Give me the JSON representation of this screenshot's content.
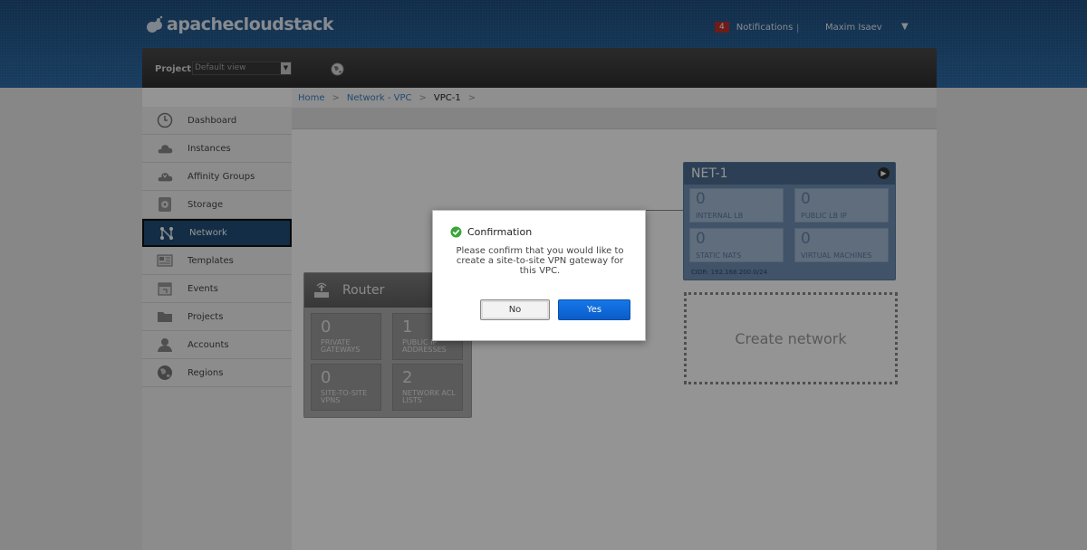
{
  "header": {
    "logo_text": "apachecloudstack",
    "notifications_count": "4",
    "notifications_label": "Notifications",
    "separator": "|",
    "user_name": "Maxim Isaev"
  },
  "project_bar": {
    "label": "Project:",
    "selected": "Default view"
  },
  "sidebar": {
    "items": [
      {
        "label": "Dashboard",
        "icon": "clock-icon"
      },
      {
        "label": "Instances",
        "icon": "cloud-icon"
      },
      {
        "label": "Affinity Groups",
        "icon": "cloud-group-icon"
      },
      {
        "label": "Storage",
        "icon": "disk-icon"
      },
      {
        "label": "Network",
        "icon": "network-icon",
        "active": true
      },
      {
        "label": "Templates",
        "icon": "template-icon"
      },
      {
        "label": "Events",
        "icon": "calendar-icon"
      },
      {
        "label": "Projects",
        "icon": "folder-icon"
      },
      {
        "label": "Accounts",
        "icon": "user-icon"
      },
      {
        "label": "Regions",
        "icon": "globe-icon"
      }
    ]
  },
  "breadcrumb": {
    "home": "Home",
    "network": "Network - VPC",
    "current": "VPC-1",
    "sep": ">"
  },
  "router": {
    "title": "Router",
    "tiles": [
      {
        "num": "0",
        "label1": "PRIVATE",
        "label2": "GATEWAYS"
      },
      {
        "num": "1",
        "label1": "PUBLIC IP",
        "label2": "ADDRESSES"
      },
      {
        "num": "0",
        "label1": "SITE-TO-SITE",
        "label2": "VPNS"
      },
      {
        "num": "2",
        "label1": "NETWORK ACL",
        "label2": "LISTS"
      }
    ]
  },
  "network_card": {
    "title": "NET-1",
    "tiles": [
      {
        "num": "0",
        "label": "INTERNAL LB"
      },
      {
        "num": "0",
        "label": "PUBLIC LB IP"
      },
      {
        "num": "0",
        "label": "STATIC NATS"
      },
      {
        "num": "0",
        "label": "VIRTUAL MACHINES"
      }
    ],
    "cidr": "CIDR: 192.168.200.0/24"
  },
  "create_network": "Create network",
  "dialog": {
    "title": "Confirmation",
    "message": "Please confirm that you would like to create a site-to-site VPN gateway for this VPC.",
    "no_label": "No",
    "yes_label": "Yes"
  },
  "colors": {
    "header_blue": "#2a6aa6",
    "active_nav": "#1f4e78",
    "yes_button": "#0a5cc9",
    "network_card": "#6e8fb5"
  }
}
